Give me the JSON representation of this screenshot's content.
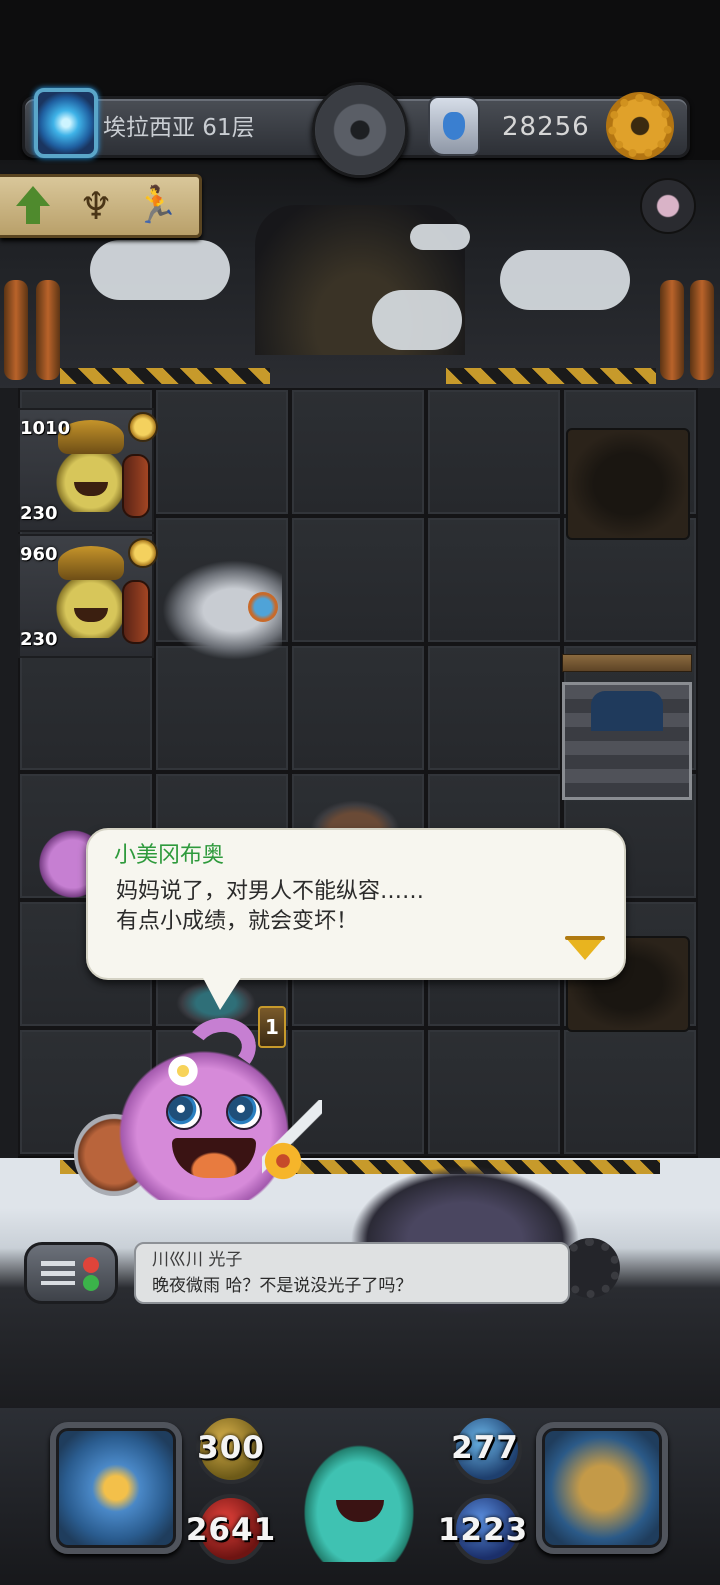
{
  "header": {
    "floor_label": "埃拉西亚 61层",
    "score": "28256",
    "icons": [
      "portal-icon",
      "center-gear-icon",
      "rune-stone-icon",
      "settings-gear-icon"
    ]
  },
  "sign": {
    "icons": [
      "green-up-arrow-icon",
      "altar-icon",
      "running-figure-icon"
    ],
    "altar_glyph": "♆",
    "runner_glyph": "🏃"
  },
  "monsters": [
    {
      "hp": "1010",
      "attack": "230"
    },
    {
      "hp": "960",
      "attack": "230"
    }
  ],
  "trap": {
    "counter": "1"
  },
  "dialog": {
    "speaker": "小美冈布奥",
    "lines": [
      "妈妈说了，对男人不能纵容……",
      "有点小成绩，就会变坏！"
    ]
  },
  "chat": {
    "user_line": "川巛川 光子",
    "message_line": "晚夜微雨 哈？不是说没光子了吗？"
  },
  "stats": {
    "attack": "300",
    "defense": "277",
    "hp": "2641",
    "mp": "1223"
  },
  "colors": {
    "speaker_name": "#2e9a3c",
    "dialog_text": "#2b2b2b",
    "bubble_bg": "#f7f6ef",
    "next_arrow": "#e8b41f"
  }
}
